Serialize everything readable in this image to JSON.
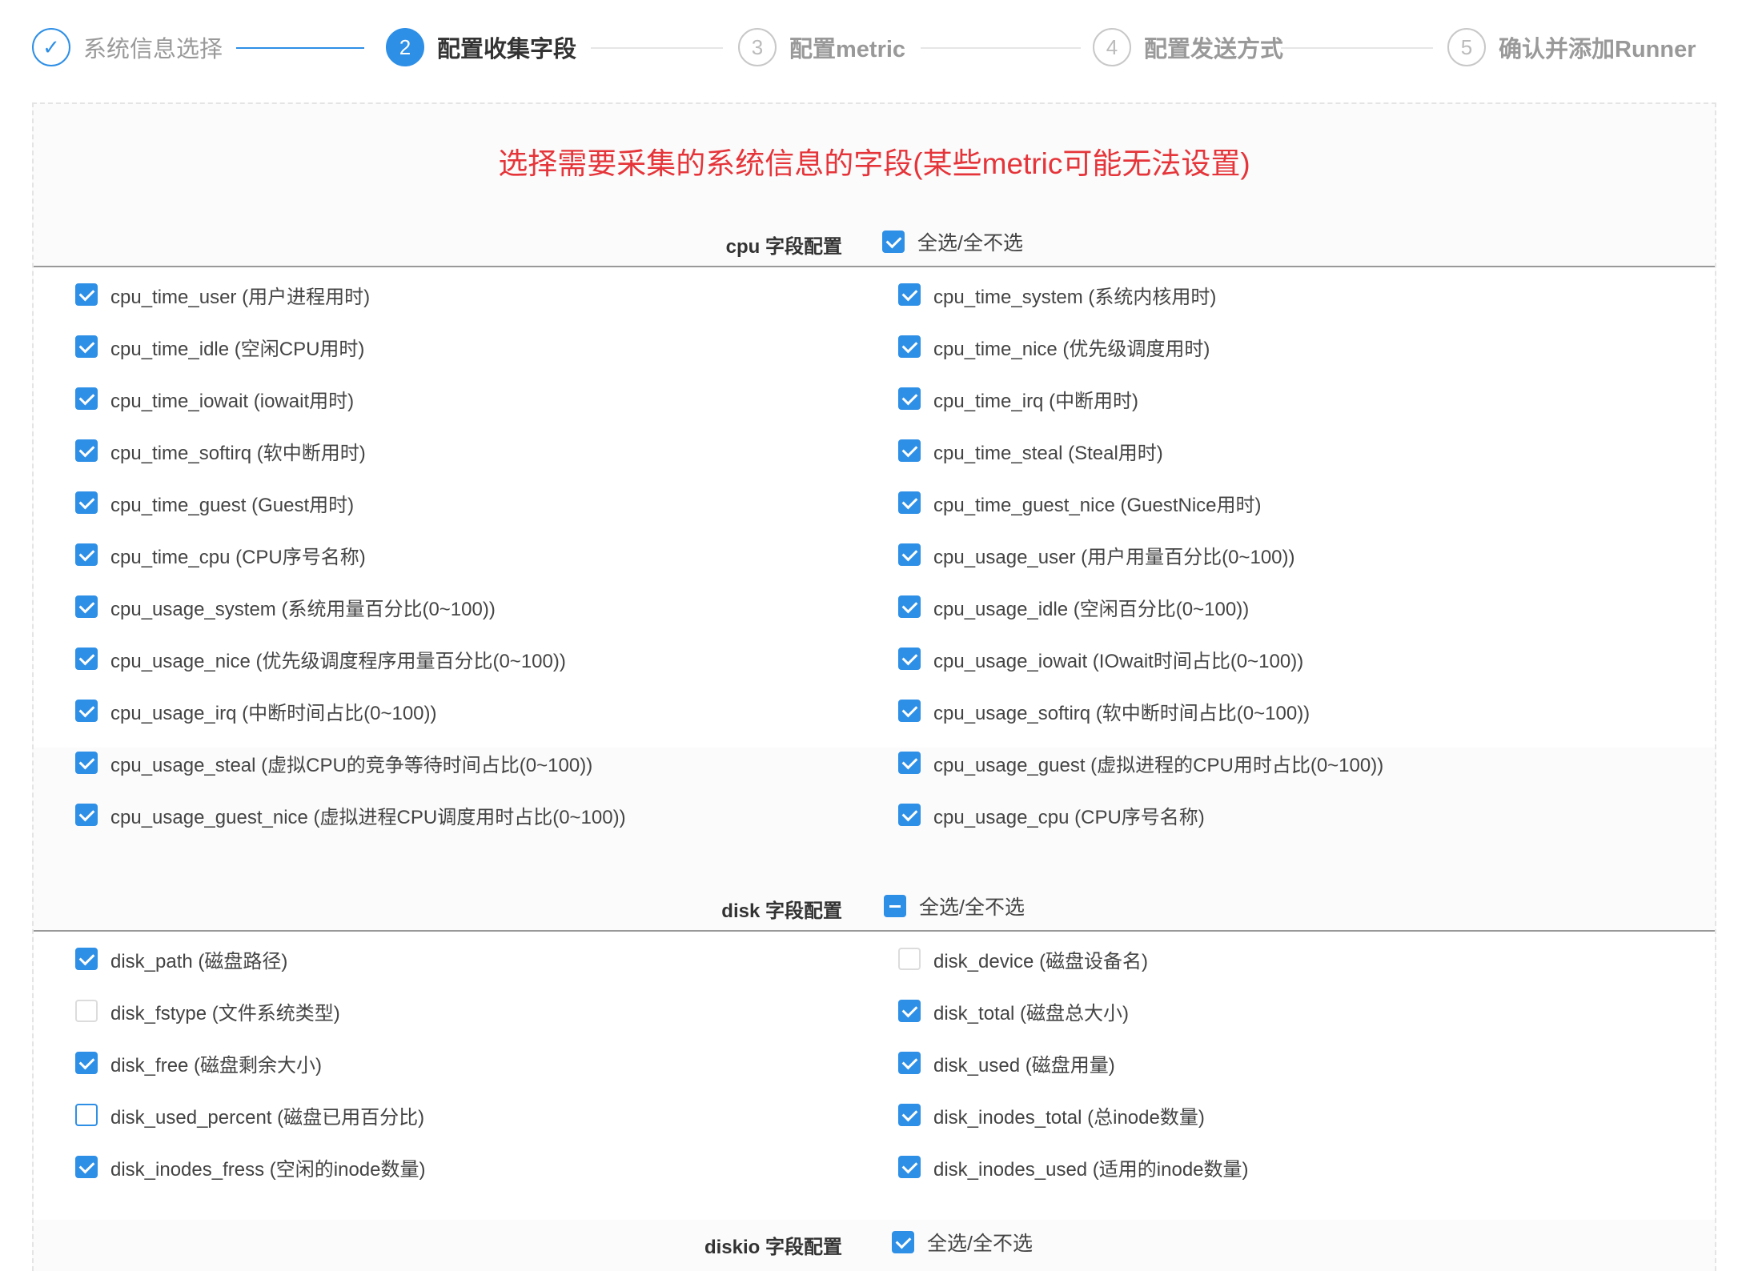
{
  "steps": [
    {
      "number": "1",
      "title": "系统信息选择",
      "state": "done"
    },
    {
      "number": "2",
      "title": "配置收集字段",
      "state": "active"
    },
    {
      "number": "3",
      "title": "配置metric",
      "state": "wait"
    },
    {
      "number": "4",
      "title": "配置发送方式",
      "state": "wait"
    },
    {
      "number": "5",
      "title": "确认并添加Runner",
      "state": "wait"
    }
  ],
  "headline": "选择需要采集的系统信息的字段(某些metric可能无法设置)",
  "select_all_label": "全选/全不选",
  "sections": {
    "cpu": {
      "name": "cpu 字段配置",
      "all_state": "checked",
      "fields": [
        {
          "label": "cpu_time_user (用户进程用时)",
          "checked": true
        },
        {
          "label": "cpu_time_system (系统内核用时)",
          "checked": true
        },
        {
          "label": "cpu_time_idle (空闲CPU用时)",
          "checked": true
        },
        {
          "label": "cpu_time_nice (优先级调度用时)",
          "checked": true
        },
        {
          "label": "cpu_time_iowait (iowait用时)",
          "checked": true
        },
        {
          "label": "cpu_time_irq (中断用时)",
          "checked": true
        },
        {
          "label": "cpu_time_softirq (软中断用时)",
          "checked": true
        },
        {
          "label": "cpu_time_steal (Steal用时)",
          "checked": true
        },
        {
          "label": "cpu_time_guest (Guest用时)",
          "checked": true
        },
        {
          "label": "cpu_time_guest_nice (GuestNice用时)",
          "checked": true
        },
        {
          "label": "cpu_time_cpu (CPU序号名称)",
          "checked": true
        },
        {
          "label": "cpu_usage_user (用户用量百分比(0~100))",
          "checked": true
        },
        {
          "label": "cpu_usage_system (系统用量百分比(0~100))",
          "checked": true
        },
        {
          "label": "cpu_usage_idle (空闲百分比(0~100))",
          "checked": true
        },
        {
          "label": "cpu_usage_nice (优先级调度程序用量百分比(0~100))",
          "checked": true
        },
        {
          "label": "cpu_usage_iowait (IOwait时间占比(0~100))",
          "checked": true
        },
        {
          "label": "cpu_usage_irq (中断时间占比(0~100))",
          "checked": true
        },
        {
          "label": "cpu_usage_softirq (软中断时间占比(0~100))",
          "checked": true
        },
        {
          "label": "cpu_usage_steal (虚拟CPU的竞争等待时间占比(0~100))",
          "checked": true
        },
        {
          "label": "cpu_usage_guest (虚拟进程的CPU用时占比(0~100))",
          "checked": true
        },
        {
          "label": "cpu_usage_guest_nice (虚拟进程CPU调度用时占比(0~100))",
          "checked": true
        },
        {
          "label": "cpu_usage_cpu (CPU序号名称)",
          "checked": true
        }
      ]
    },
    "disk": {
      "name": "disk 字段配置",
      "all_state": "partial",
      "fields": [
        {
          "label": "disk_path (磁盘路径)",
          "checked": true
        },
        {
          "label": "disk_device (磁盘设备名)",
          "checked": false
        },
        {
          "label": "disk_fstype (文件系统类型)",
          "checked": false
        },
        {
          "label": "disk_total (磁盘总大小)",
          "checked": true
        },
        {
          "label": "disk_free (磁盘剩余大小)",
          "checked": true
        },
        {
          "label": "disk_used (磁盘用量)",
          "checked": true
        },
        {
          "label": "disk_used_percent (磁盘已用百分比)",
          "checked": false,
          "focused": true
        },
        {
          "label": "disk_inodes_total (总inode数量)",
          "checked": true
        },
        {
          "label": "disk_inodes_fress (空闲的inode数量)",
          "checked": true
        },
        {
          "label": "disk_inodes_used (适用的inode数量)",
          "checked": true
        }
      ]
    },
    "diskio": {
      "name": "diskio 字段配置",
      "all_state": "checked"
    }
  },
  "colors": {
    "primary": "#2e8fe6",
    "headline": "#e5353a"
  }
}
